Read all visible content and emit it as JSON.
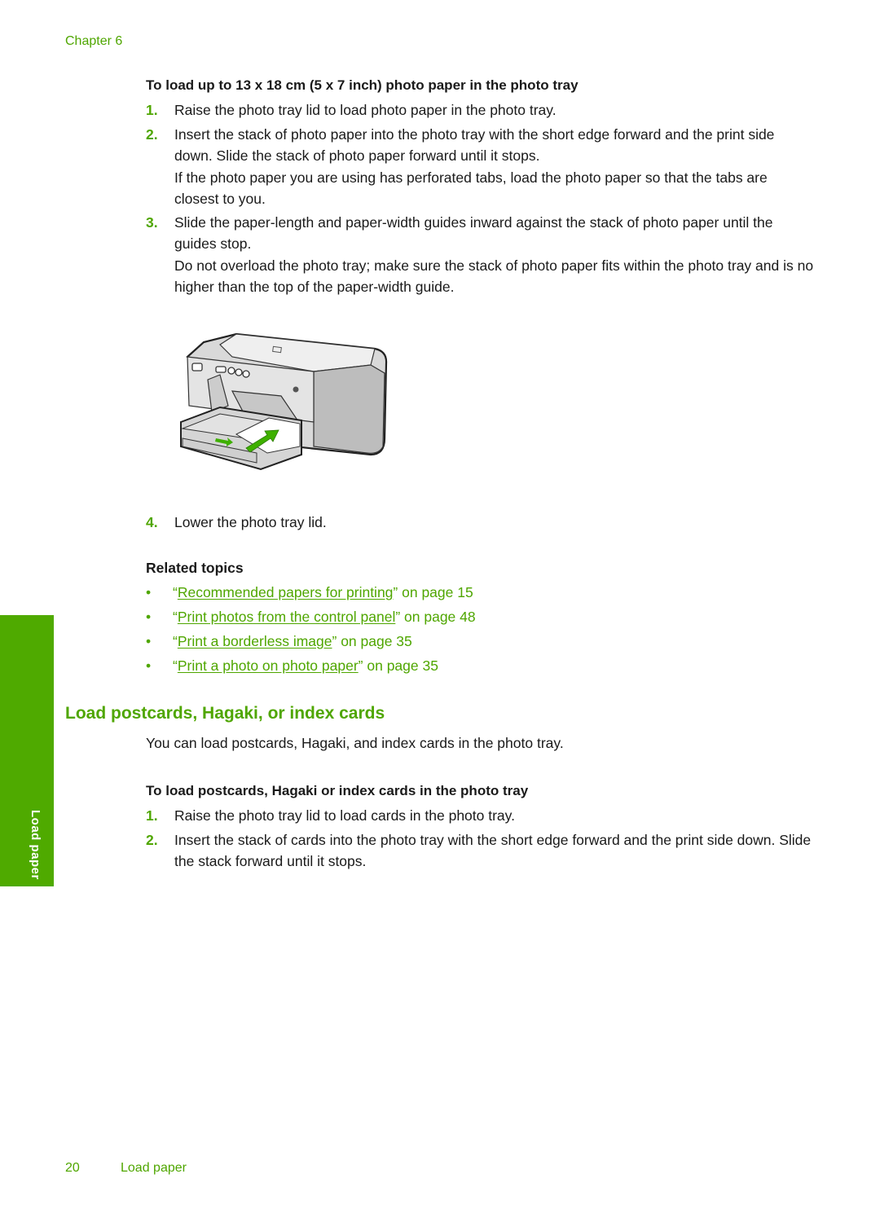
{
  "header": {
    "chapter": "Chapter 6"
  },
  "procedure1": {
    "title": "To load up to 13 x 18 cm (5 x 7 inch) photo paper in the photo tray",
    "steps": [
      {
        "num": "1.",
        "text": "Raise the photo tray lid to load photo paper in the photo tray."
      },
      {
        "num": "2.",
        "text": "Insert the stack of photo paper into the photo tray with the short edge forward and the print side down. Slide the stack of photo paper forward until it stops.",
        "note": "If the photo paper you are using has perforated tabs, load the photo paper so that the tabs are closest to you."
      },
      {
        "num": "3.",
        "text": "Slide the paper-length and paper-width guides inward against the stack of photo paper until the guides stop.",
        "note": "Do not overload the photo tray; make sure the stack of photo paper fits within the photo tray and is no higher than the top of the paper-width guide."
      },
      {
        "num": "4.",
        "text": "Lower the photo tray lid."
      }
    ],
    "illustration": "printer-photo-tray-illustration"
  },
  "related": {
    "title": "Related topics",
    "bullet": "•",
    "items": [
      {
        "link": "Recommended papers for printing",
        "suffix": "” on page 15"
      },
      {
        "link": "Print photos from the control panel",
        "suffix": "” on page 48"
      },
      {
        "link": "Print a borderless image",
        "suffix": "” on page 35"
      },
      {
        "link": "Print a photo on photo paper",
        "suffix": "” on page 35"
      }
    ],
    "open_quote": "“"
  },
  "section2": {
    "title": "Load postcards, Hagaki, or index cards",
    "intro": "You can load postcards, Hagaki, and index cards in the photo tray.",
    "procedure_title": "To load postcards, Hagaki or index cards in the photo tray",
    "steps": [
      {
        "num": "1.",
        "text": "Raise the photo tray lid to load cards in the photo tray."
      },
      {
        "num": "2.",
        "text": "Insert the stack of cards into the photo tray with the short edge forward and the print side down. Slide the stack forward until it stops."
      }
    ]
  },
  "sidetab": {
    "label": "Load paper",
    "color": "#4faa00"
  },
  "footer": {
    "page": "20",
    "section": "Load paper"
  },
  "colors": {
    "accent": "#4fa600",
    "text": "#1a1a1a"
  }
}
